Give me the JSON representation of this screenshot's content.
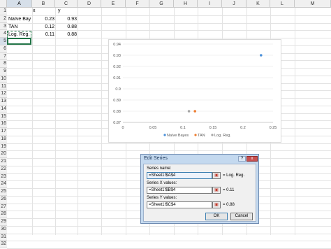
{
  "columns": [
    "A",
    "B",
    "C",
    "D",
    "E",
    "F",
    "G",
    "H",
    "I",
    "J",
    "K",
    "L",
    "M"
  ],
  "active_column": "A",
  "rows": [
    "1",
    "2",
    "3",
    "4",
    "5",
    "6",
    "7",
    "8",
    "9",
    "10",
    "11",
    "12",
    "13",
    "14",
    "15",
    "16",
    "17",
    "18",
    "19",
    "20",
    "21",
    "22",
    "23",
    "24",
    "25",
    "26",
    "27",
    "28",
    "29",
    "30",
    "31",
    "32"
  ],
  "active_row": "5",
  "sheet": {
    "header": {
      "b": "x",
      "c": "y"
    },
    "data": [
      {
        "a": "Naïve Bay",
        "b": "0.23",
        "c": "0.93"
      },
      {
        "a": "TAN",
        "b": "0.12",
        "c": "0.88"
      },
      {
        "a": "Log. Reg.",
        "b": "0.11",
        "c": "0.88"
      }
    ]
  },
  "chart_data": {
    "type": "scatter",
    "xlim": [
      0,
      0.25
    ],
    "ylim": [
      0.87,
      0.94
    ],
    "x_ticks": [
      "0",
      "0.05",
      "0.1",
      "0.15",
      "0.2",
      "0.25"
    ],
    "y_ticks": [
      "0.87",
      "0.88",
      "0.89",
      "0.9",
      "0.91",
      "0.92",
      "0.93",
      "0.94"
    ],
    "grid": true,
    "legend_position": "bottom",
    "series": [
      {
        "name": "Naïve Bayes",
        "color": "#4a90d9",
        "x": [
          0.23
        ],
        "y": [
          0.93
        ]
      },
      {
        "name": "TAN",
        "color": "#ed7d31",
        "x": [
          0.12
        ],
        "y": [
          0.88
        ]
      },
      {
        "name": "Log. Reg.",
        "color": "#a5a5a5",
        "x": [
          0.11
        ],
        "y": [
          0.88
        ]
      }
    ]
  },
  "dialog": {
    "title": "Edit Series",
    "help_label": "?",
    "close_label": "x",
    "name_label": "Series name:",
    "name_value": "=Sheet1!$A$4",
    "name_result": "= Log. Reg.",
    "x_label": "Series X values:",
    "x_value": "=Sheet1!$B$4",
    "x_result": "= 0.11",
    "y_label": "Series Y values:",
    "y_value": "=Sheet1!$C$4",
    "y_result": "= 0.88",
    "ok_label": "OK",
    "cancel_label": "Cancel"
  }
}
